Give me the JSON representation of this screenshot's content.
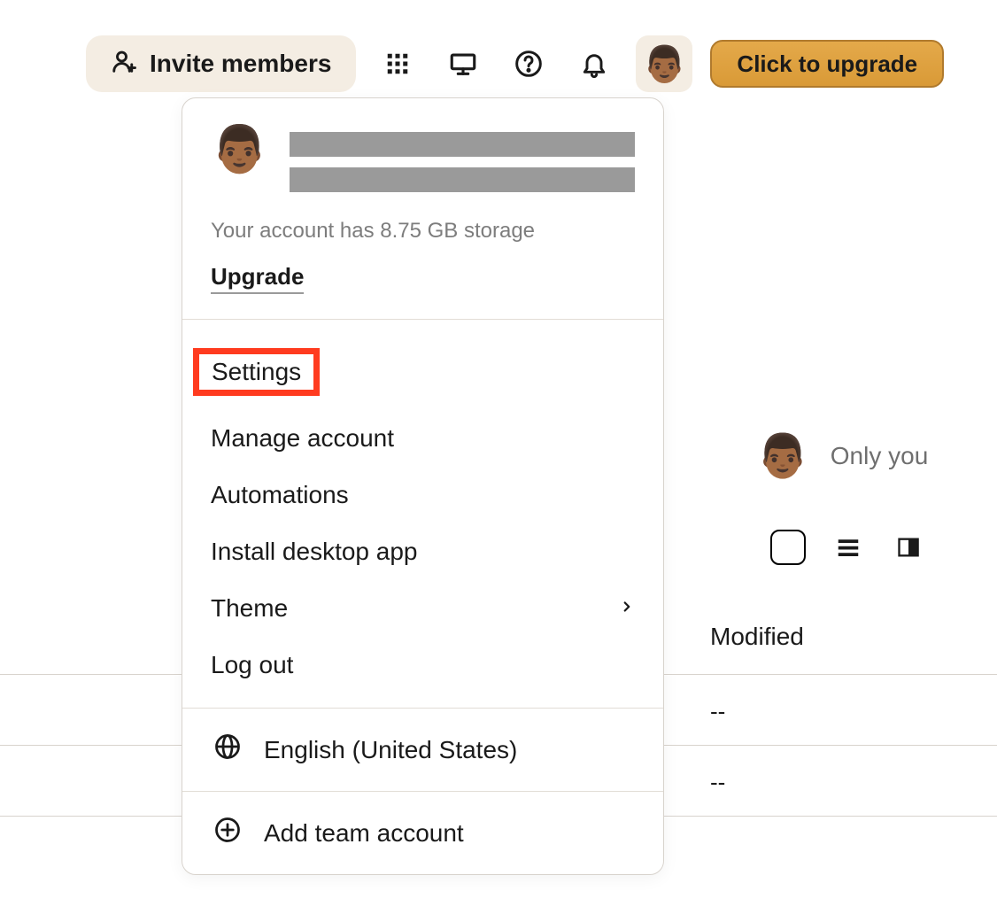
{
  "toolbar": {
    "invite_label": "Invite members",
    "upgrade_cta": "Click to upgrade"
  },
  "avatar_emoji": "👨🏾",
  "dropdown": {
    "storage_text": "Your account has 8.75 GB storage",
    "upgrade_link": "Upgrade",
    "menu_items": [
      {
        "label": "Settings",
        "highlighted": true
      },
      {
        "label": "Manage account"
      },
      {
        "label": "Automations"
      },
      {
        "label": "Install desktop app"
      },
      {
        "label": "Theme",
        "chevron": true
      },
      {
        "label": "Log out"
      }
    ],
    "language": "English (United States)",
    "add_team": "Add team account"
  },
  "content": {
    "sharing_text": "Only you",
    "column_header": "Modified",
    "rows": [
      {
        "modified": "--"
      },
      {
        "modified": "--"
      }
    ]
  }
}
